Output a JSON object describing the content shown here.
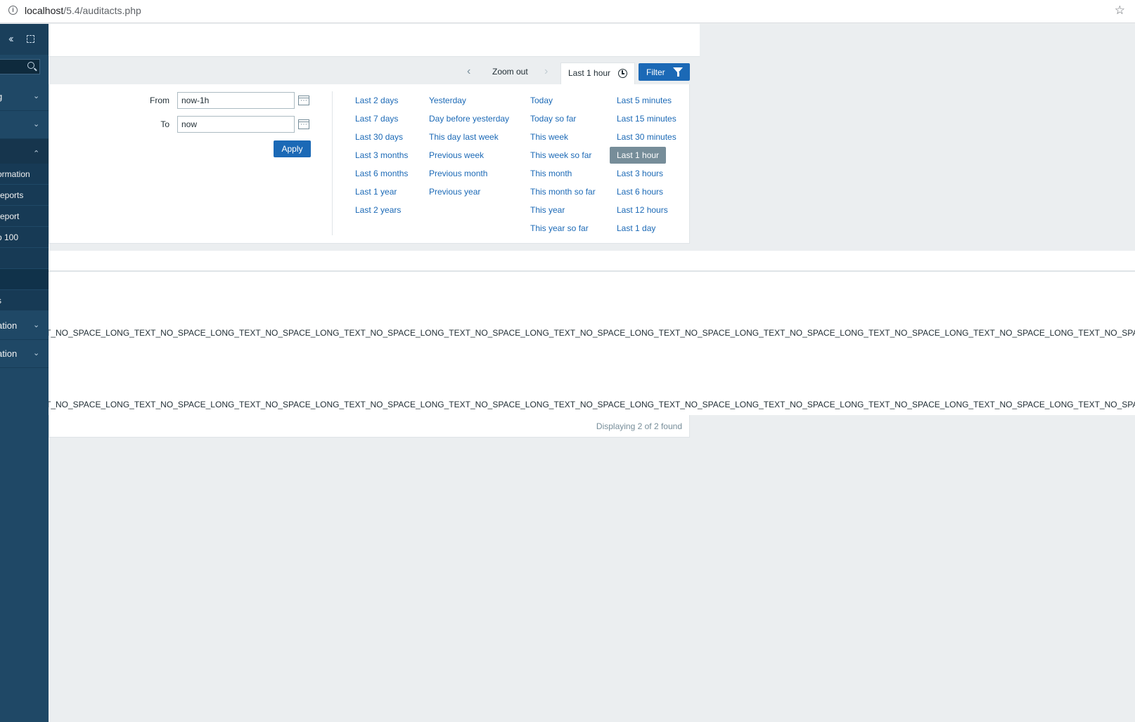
{
  "browser": {
    "url_host": "localhost",
    "url_path": "/5.4/auditacts.php"
  },
  "sidebar": {
    "menus": [
      {
        "label": "g",
        "state": "collapsed"
      },
      {
        "label": "",
        "state": "collapsed"
      },
      {
        "label": "",
        "state": "expanded"
      }
    ],
    "subitems": [
      "ormation",
      "reports",
      "report",
      "p 100",
      "",
      "",
      "s"
    ],
    "bottom_menus": [
      "ation",
      "ation"
    ]
  },
  "time_tabs": {
    "zoom_out": "Zoom out",
    "time_tab_label": "Last 1 hour",
    "filter_label": "Filter"
  },
  "time_panel": {
    "from_label": "From",
    "from_value": "now-1h",
    "to_label": "To",
    "to_value": "now",
    "apply_label": "Apply",
    "quick_ranges": [
      [
        "Last 2 days",
        "Last 7 days",
        "Last 30 days",
        "Last 3 months",
        "Last 6 months",
        "Last 1 year",
        "Last 2 years"
      ],
      [
        "Yesterday",
        "Day before yesterday",
        "This day last week",
        "Previous week",
        "Previous month",
        "Previous year"
      ],
      [
        "Today",
        "Today so far",
        "This week",
        "This week so far",
        "This month",
        "This month so far",
        "This year",
        "This year so far"
      ],
      [
        "Last 5 minutes",
        "Last 15 minutes",
        "Last 30 minutes",
        "Last 1 hour",
        "Last 3 hours",
        "Last 6 hours",
        "Last 12 hours",
        "Last 1 day"
      ]
    ],
    "selected_range": "Last 1 hour"
  },
  "table": {
    "rows": [
      {
        "message": "T_NO_SPACE_LONG_TEXT_NO_SPACE_LONG_TEXT_NO_SPACE_LONG_TEXT_NO_SPACE_LONG_TEXT_NO_SPACE_LONG_TEXT_NO_SPACE_LONG_TEXT_NO_SPACE_LONG_TEXT_NO_SPACE_LONG_TEXT_NO_SPACE_LONG_TEXT_NO_SPACE_LONG_TEXT_NO_SPACE_LONG_TEXT_NO_SPACE_LONG_TEXT_NO_SPACE_LONG_TEXT_NO_SP"
      },
      {
        "message": "T_NO_SPACE_LONG_TEXT_NO_SPACE_LONG_TEXT_NO_SPACE_LONG_TEXT_NO_SPACE_LONG_TEXT_NO_SPACE_LONG_TEXT_NO_SPACE_LONG_TEXT_NO_SPACE_LONG_TEXT_NO_SPACE_LONG_TEXT_NO_SPACE_LONG_TEXT_NO_SPACE_LONG_TEXT_NO_SPACE_LONG_TEXT_NO_SPACE_LONG_TEXT_NO_SPACE_LONG_TEXT_NO_SP"
      }
    ],
    "paging": "Displaying 2 of 2 found"
  },
  "colors": {
    "accent": "#1b69b6",
    "sidebar": "#1f4866",
    "page_bg": "#ebeef0",
    "selected_range_bg": "#768d99"
  }
}
